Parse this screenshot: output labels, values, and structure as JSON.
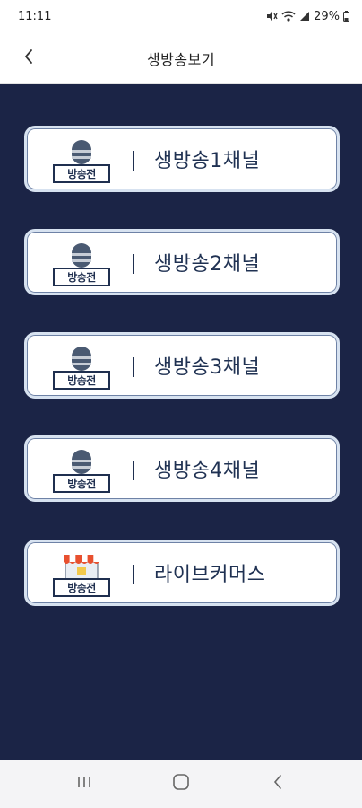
{
  "status_bar": {
    "time": "11:11",
    "battery": "29%",
    "icons": [
      "mute-icon",
      "wifi-icon",
      "signal-icon",
      "battery-icon"
    ]
  },
  "app_bar": {
    "title": "생방송보기",
    "back_icon": "chevron-left-icon"
  },
  "channels": [
    {
      "label": "생방송1채널",
      "badge": "방송전",
      "icon": "microphone-icon"
    },
    {
      "label": "생방송2채널",
      "badge": "방송전",
      "icon": "microphone-icon"
    },
    {
      "label": "생방송3채널",
      "badge": "방송전",
      "icon": "microphone-icon"
    },
    {
      "label": "생방송4채널",
      "badge": "방송전",
      "icon": "microphone-icon"
    },
    {
      "label": "라이브커머스",
      "badge": "방송전",
      "icon": "storefront-icon"
    }
  ],
  "nav_bar": {
    "buttons": [
      "recent-apps-icon",
      "home-icon",
      "back-icon"
    ]
  },
  "colors": {
    "background": "#1b2446",
    "text_dark": "#1f3152",
    "card": "#ffffff",
    "awning_red": "#e8502f",
    "awning_white": "#ffffff"
  }
}
